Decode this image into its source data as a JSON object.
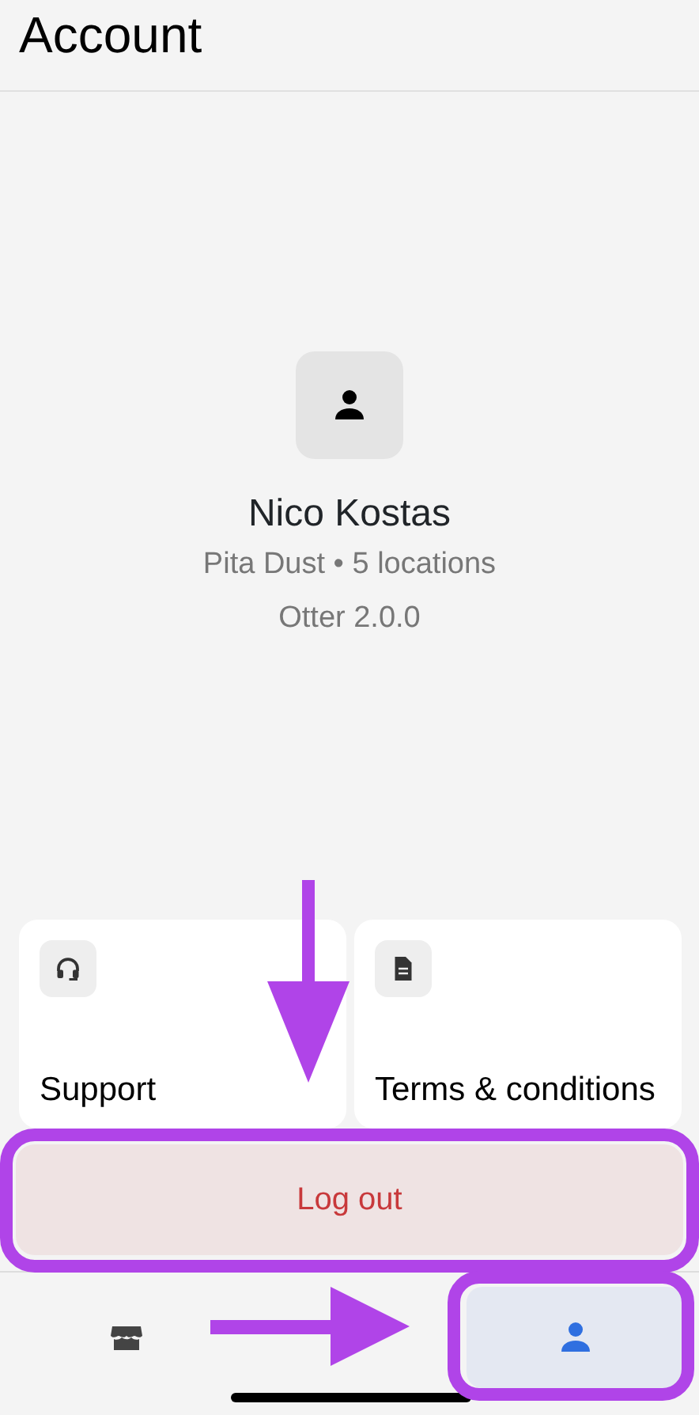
{
  "header": {
    "title": "Account"
  },
  "profile": {
    "name": "Nico Kostas",
    "subtitle": "Pita Dust • 5 locations",
    "version": "Otter 2.0.0"
  },
  "cards": [
    {
      "kind": "support",
      "label": "Support"
    },
    {
      "kind": "terms",
      "label": "Terms & conditions"
    }
  ],
  "logout": {
    "label": "Log out"
  },
  "tabs": [
    {
      "kind": "store",
      "selected": false
    },
    {
      "kind": "account",
      "selected": true
    }
  ],
  "annotations": [
    {
      "kind": "arrow-down"
    },
    {
      "kind": "highlight-logout"
    },
    {
      "kind": "arrow-right"
    },
    {
      "kind": "highlight-tab"
    }
  ]
}
